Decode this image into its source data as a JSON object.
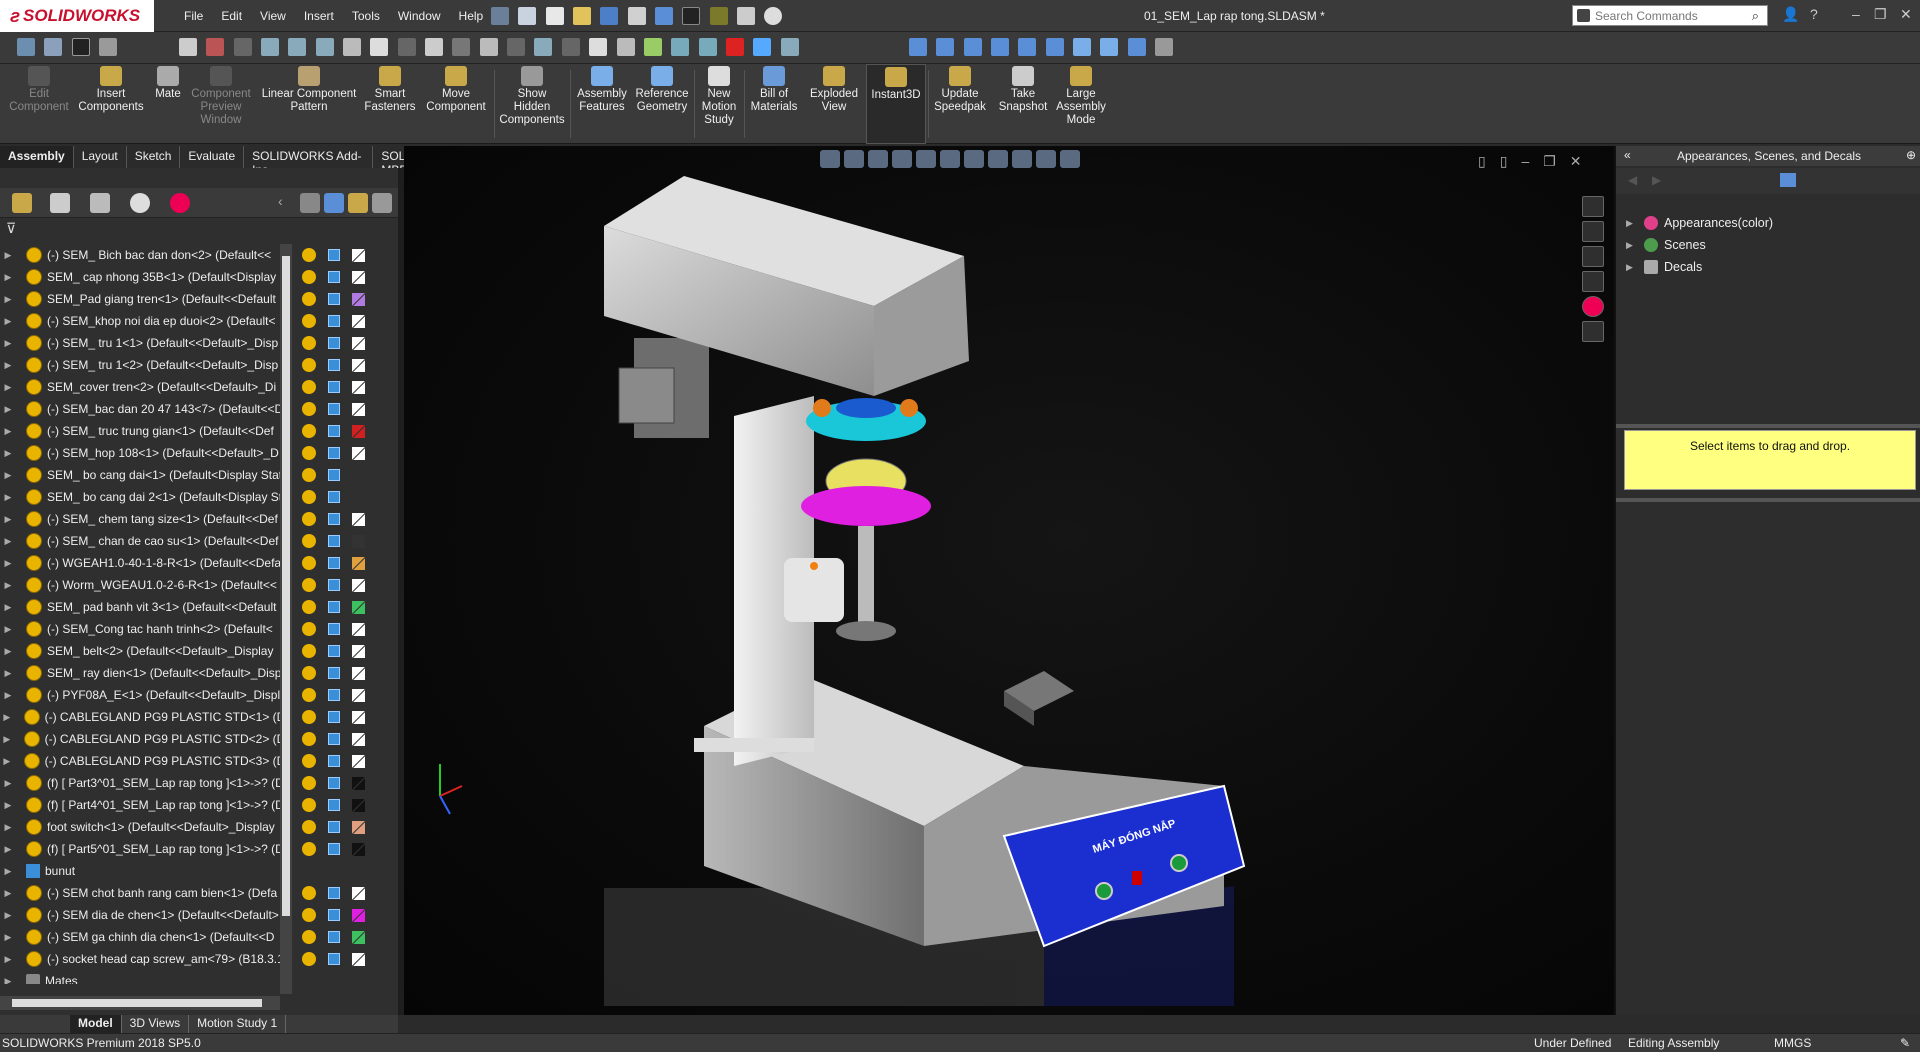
{
  "app": {
    "brand": "SOLIDWORKS",
    "document_title": "01_SEM_Lap rap tong.SLDASM *"
  },
  "menu": [
    "File",
    "Edit",
    "View",
    "Insert",
    "Tools",
    "Window",
    "Help"
  ],
  "search": {
    "placeholder": "Search Commands"
  },
  "ribbon": {
    "edit_component": "Edit Component",
    "insert_components": "Insert Components",
    "mate": "Mate",
    "component_preview": "Component Preview Window",
    "linear_pattern": "Linear Component Pattern",
    "smart_fasteners": "Smart Fasteners",
    "move_component": "Move Component",
    "show_hidden": "Show Hidden Components",
    "assembly_features": "Assembly Features",
    "reference_geometry": "Reference Geometry",
    "new_motion": "New Motion Study",
    "bom": "Bill of Materials",
    "exploded_view": "Exploded View",
    "instant3d": "Instant3D",
    "speedpak": "Update Speedpak",
    "snapshot": "Take Snapshot",
    "large_assembly": "Large Assembly Mode"
  },
  "command_tabs": [
    "Assembly",
    "Layout",
    "Sketch",
    "Evaluate",
    "SOLIDWORKS Add-Ins",
    "SOLIDWORKS MBD"
  ],
  "tree": {
    "items": [
      "(-) SEM_ Bich bac dan don<2> (Default<<",
      "SEM_ cap nhong 35B<1> (Default<Display",
      "SEM_Pad giang tren<1> (Default<<Default",
      "(-) SEM_khop noi dia ep duoi<2> (Default<",
      "(-) SEM_ tru 1<1> (Default<<Default>_Disp",
      "(-) SEM_ tru 1<2> (Default<<Default>_Disp",
      "SEM_cover tren<2> (Default<<Default>_Di",
      "(-) SEM_bac dan 20 47 143<7> (Default<<D",
      "(-) SEM_ truc trung gian<1> (Default<<Def",
      "(-) SEM_hop 108<1> (Default<<Default>_D",
      "SEM_ bo cang dai<1> (Default<Display Stat",
      "SEM_ bo cang dai 2<1> (Default<Display St",
      "(-) SEM_ chem tang size<1> (Default<<Def",
      "(-) SEM_ chan de cao su<1> (Default<<Def",
      "(-) WGEAH1.0-40-1-8-R<1> (Default<<Defa",
      "(-) Worm_WGEAU1.0-2-6-R<1> (Default<<",
      "SEM_ pad banh vit 3<1> (Default<<Default",
      "(-) SEM_Cong tac hanh trinh<2> (Default<",
      "SEM_ belt<2> (Default<<Default>_Display",
      "SEM_ ray dien<1> (Default<<Default>_Disp",
      "(-) PYF08A_E<1> (Default<<Default>_Displ",
      "(-) CABLEGLAND PG9 PLASTIC STD<1> (De",
      "(-) CABLEGLAND PG9 PLASTIC STD<2> (De",
      "(-) CABLEGLAND PG9 PLASTIC STD<3> (De",
      "(f) [ Part3^01_SEM_Lap rap tong ]<1>->? (D",
      "(f) [ Part4^01_SEM_Lap rap tong ]<1>->? (D",
      "foot switch<1> (Default<<Default>_Display",
      "(f) [ Part5^01_SEM_Lap rap tong ]<1>->? (D",
      "bunut",
      "(-) SEM chot banh rang cam bien<1> (Defa",
      "(-) SEM dia de chen<1> (Default<<Default>",
      "(-) SEM ga chinh dia chen<1> (Default<<D",
      "(-) socket head cap screw_am<79> (B18.3.1",
      "Mates"
    ]
  },
  "bottom_tabs": [
    "Model",
    "3D Views",
    "Motion Study 1"
  ],
  "right_panel": {
    "title": "Appearances, Scenes, and Decals",
    "items": [
      "Appearances(color)",
      "Scenes",
      "Decals"
    ],
    "hint": "Select items to drag and drop."
  },
  "status": {
    "version": "SOLIDWORKS Premium 2018 SP5.0",
    "defined": "Under Defined",
    "mode": "Editing Assembly",
    "units": "MMGS"
  },
  "machine_label": "MÁY ĐÓNG NẮP"
}
